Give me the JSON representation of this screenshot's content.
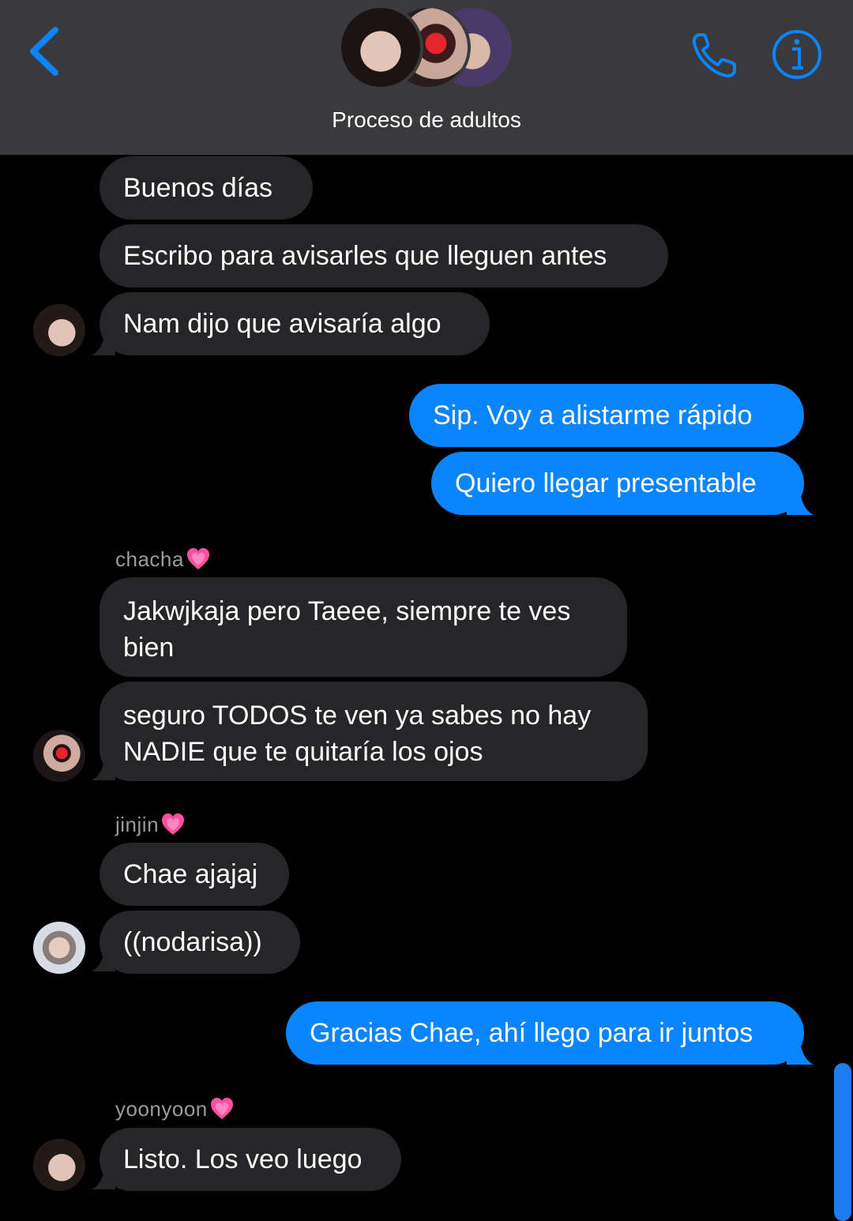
{
  "header": {
    "title": "Proceso de adultos",
    "back_icon": "chevron-left-icon",
    "call_icon": "phone-icon",
    "info_icon": "info-icon",
    "accent": "#0a84ff"
  },
  "colors": {
    "incoming_bubble": "#262628",
    "outgoing_bubble": "#0a84ff",
    "sender_name": "#9a9a9f",
    "background": "#000000"
  },
  "messages": [
    {
      "text": "Buenos días",
      "direction": "incoming"
    },
    {
      "text": "Escribo para avisarles que lleguen antes",
      "direction": "incoming"
    },
    {
      "text": "Nam dijo que avisaría algo",
      "direction": "incoming"
    },
    {
      "text": "Sip. Voy a alistarme rápido",
      "direction": "outgoing"
    },
    {
      "text": "Quiero llegar presentable",
      "direction": "outgoing"
    },
    {
      "sender": "chacha",
      "text": "Jakwjkaja pero Taeee, siempre te ves bien",
      "direction": "incoming"
    },
    {
      "text": "seguro TODOS te ven ya sabes no hay NADIE que te quitaría los ojos",
      "direction": "incoming"
    },
    {
      "sender": "jinjin",
      "text": "Chae ajajaj",
      "direction": "incoming"
    },
    {
      "text": "((nodarisa))",
      "direction": "incoming"
    },
    {
      "text": "Gracias Chae, ahí llego para ir juntos",
      "direction": "outgoing"
    },
    {
      "sender": "yoonyoon",
      "text": "Listo. Los veo luego",
      "direction": "incoming"
    }
  ]
}
